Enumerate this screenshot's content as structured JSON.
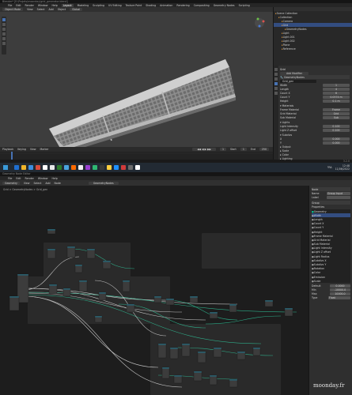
{
  "top_window": {
    "title": "Blender* [E:\\Projets\\moonday\\grid_generator.blend]",
    "menu": [
      "File",
      "Edit",
      "Render",
      "Window",
      "Help"
    ],
    "workspace_tabs": [
      "Layout",
      "Modeling",
      "Sculpting",
      "UV Editing",
      "Texture Paint",
      "Shading",
      "Animation",
      "Rendering",
      "Compositing",
      "Geometry Nodes",
      "Scripting"
    ],
    "viewport_header": {
      "mode": "Object Mode",
      "view": "View",
      "select": "Select",
      "add": "Add",
      "object": "Object",
      "transform": "Global"
    },
    "timeline": {
      "labels": [
        "Playback",
        "Keying",
        "View",
        "Marker"
      ],
      "frame": "1",
      "start": "Start",
      "start_val": "1",
      "end": "End",
      "end_val": "250"
    },
    "status_version": "3.2.0"
  },
  "outliner": {
    "items": [
      {
        "label": "Scene Collection",
        "indent": 0
      },
      {
        "label": "Collection",
        "indent": 1
      },
      {
        "label": "Camera",
        "indent": 2
      },
      {
        "label": "Grid",
        "indent": 2
      },
      {
        "label": "GeometryNodes",
        "indent": 3
      },
      {
        "label": "Light",
        "indent": 2
      },
      {
        "label": "Light.001",
        "indent": 2
      },
      {
        "label": "Light.002",
        "indent": 2
      },
      {
        "label": "Plane",
        "indent": 2
      },
      {
        "label": "Reference",
        "indent": 2
      }
    ]
  },
  "properties": {
    "object": "Grid",
    "modifier_name": "GeometryNodes",
    "add_modifier": "Add Modifier",
    "node_group": "Grid_gen",
    "fields": [
      {
        "label": "Width",
        "value": "1"
      },
      {
        "label": "Length",
        "value": "4"
      },
      {
        "label": "Count X",
        "value": "6"
      },
      {
        "label": "Count Y",
        "value": "0.0374 m"
      },
      {
        "label": "Height",
        "value": "0.1 m"
      }
    ],
    "sections": [
      {
        "label": "Materials",
        "rows": [
          {
            "label": "Frame Material",
            "value": "Frame"
          },
          {
            "label": "Grid Material",
            "value": "Grid"
          },
          {
            "label": "Sub Material",
            "value": "Sub"
          }
        ]
      },
      {
        "label": "Lights",
        "rows": [
          {
            "label": "Light Intensity",
            "value": "0.100"
          },
          {
            "label": "Light Z offset",
            "value": "0.100"
          }
        ]
      },
      {
        "label": "Subdivs",
        "rows": [
          {
            "label": "X",
            "value": "0.000"
          },
          {
            "label": "Y",
            "value": "0.000"
          }
        ]
      }
    ],
    "collapsed": [
      "Output",
      "Scale",
      "Color",
      "Lighting"
    ]
  },
  "taskbar": {
    "icons": [
      "#1f6fd1",
      "#f0b429",
      "#3c8dde",
      "#d94a3b",
      "#ffffff",
      "#e8e8e8",
      "#2b7a2b",
      "#4aa3df",
      "#ff6a00",
      "#f0f0f0",
      "#9a3fd1",
      "#2eb872",
      "#3a3a3a",
      "#ffcf3f",
      "#1e90ff",
      "#d13b3b",
      "#6a6a6a",
      "#ffffff"
    ],
    "time": "12:48",
    "date": "11/06/2022",
    "lang": "FRA"
  },
  "bottom_window": {
    "title": "Geometry Node Editor",
    "menu": [
      "File",
      "Edit",
      "Render",
      "Window",
      "Help"
    ],
    "header": {
      "editor": "Geometry",
      "node_group": "GeometryNodes",
      "view": "View",
      "select": "Select",
      "add": "Add",
      "node": "Node"
    },
    "breadcrumb": "Grid  >  GeometryNodes  >  Grid_gen",
    "side_panel": {
      "tab_node": "Node",
      "name_label": "Name",
      "name_value": "Group Input",
      "label_label": "Label",
      "group_label": "Group",
      "properties_header": "Properties",
      "inputs": [
        "Geometry",
        "Width",
        "Length",
        "Count X",
        "Count Y",
        "Height",
        "Frame Material",
        "Grid Material",
        "Sub Material",
        "Light Intensity",
        "Light Z offset",
        "Light Radius",
        "Subdivs X",
        "Subdivs Y",
        "Rotation",
        "Color",
        "Emission",
        "Scale"
      ],
      "value_rows": [
        {
          "label": "Default",
          "value": "0.0000"
        },
        {
          "label": "Min",
          "value": "-10000.0"
        },
        {
          "label": "Max",
          "value": "10000.0"
        }
      ],
      "type_label": "Type",
      "type_value": "Float"
    }
  },
  "watermark": "moonday.fr"
}
